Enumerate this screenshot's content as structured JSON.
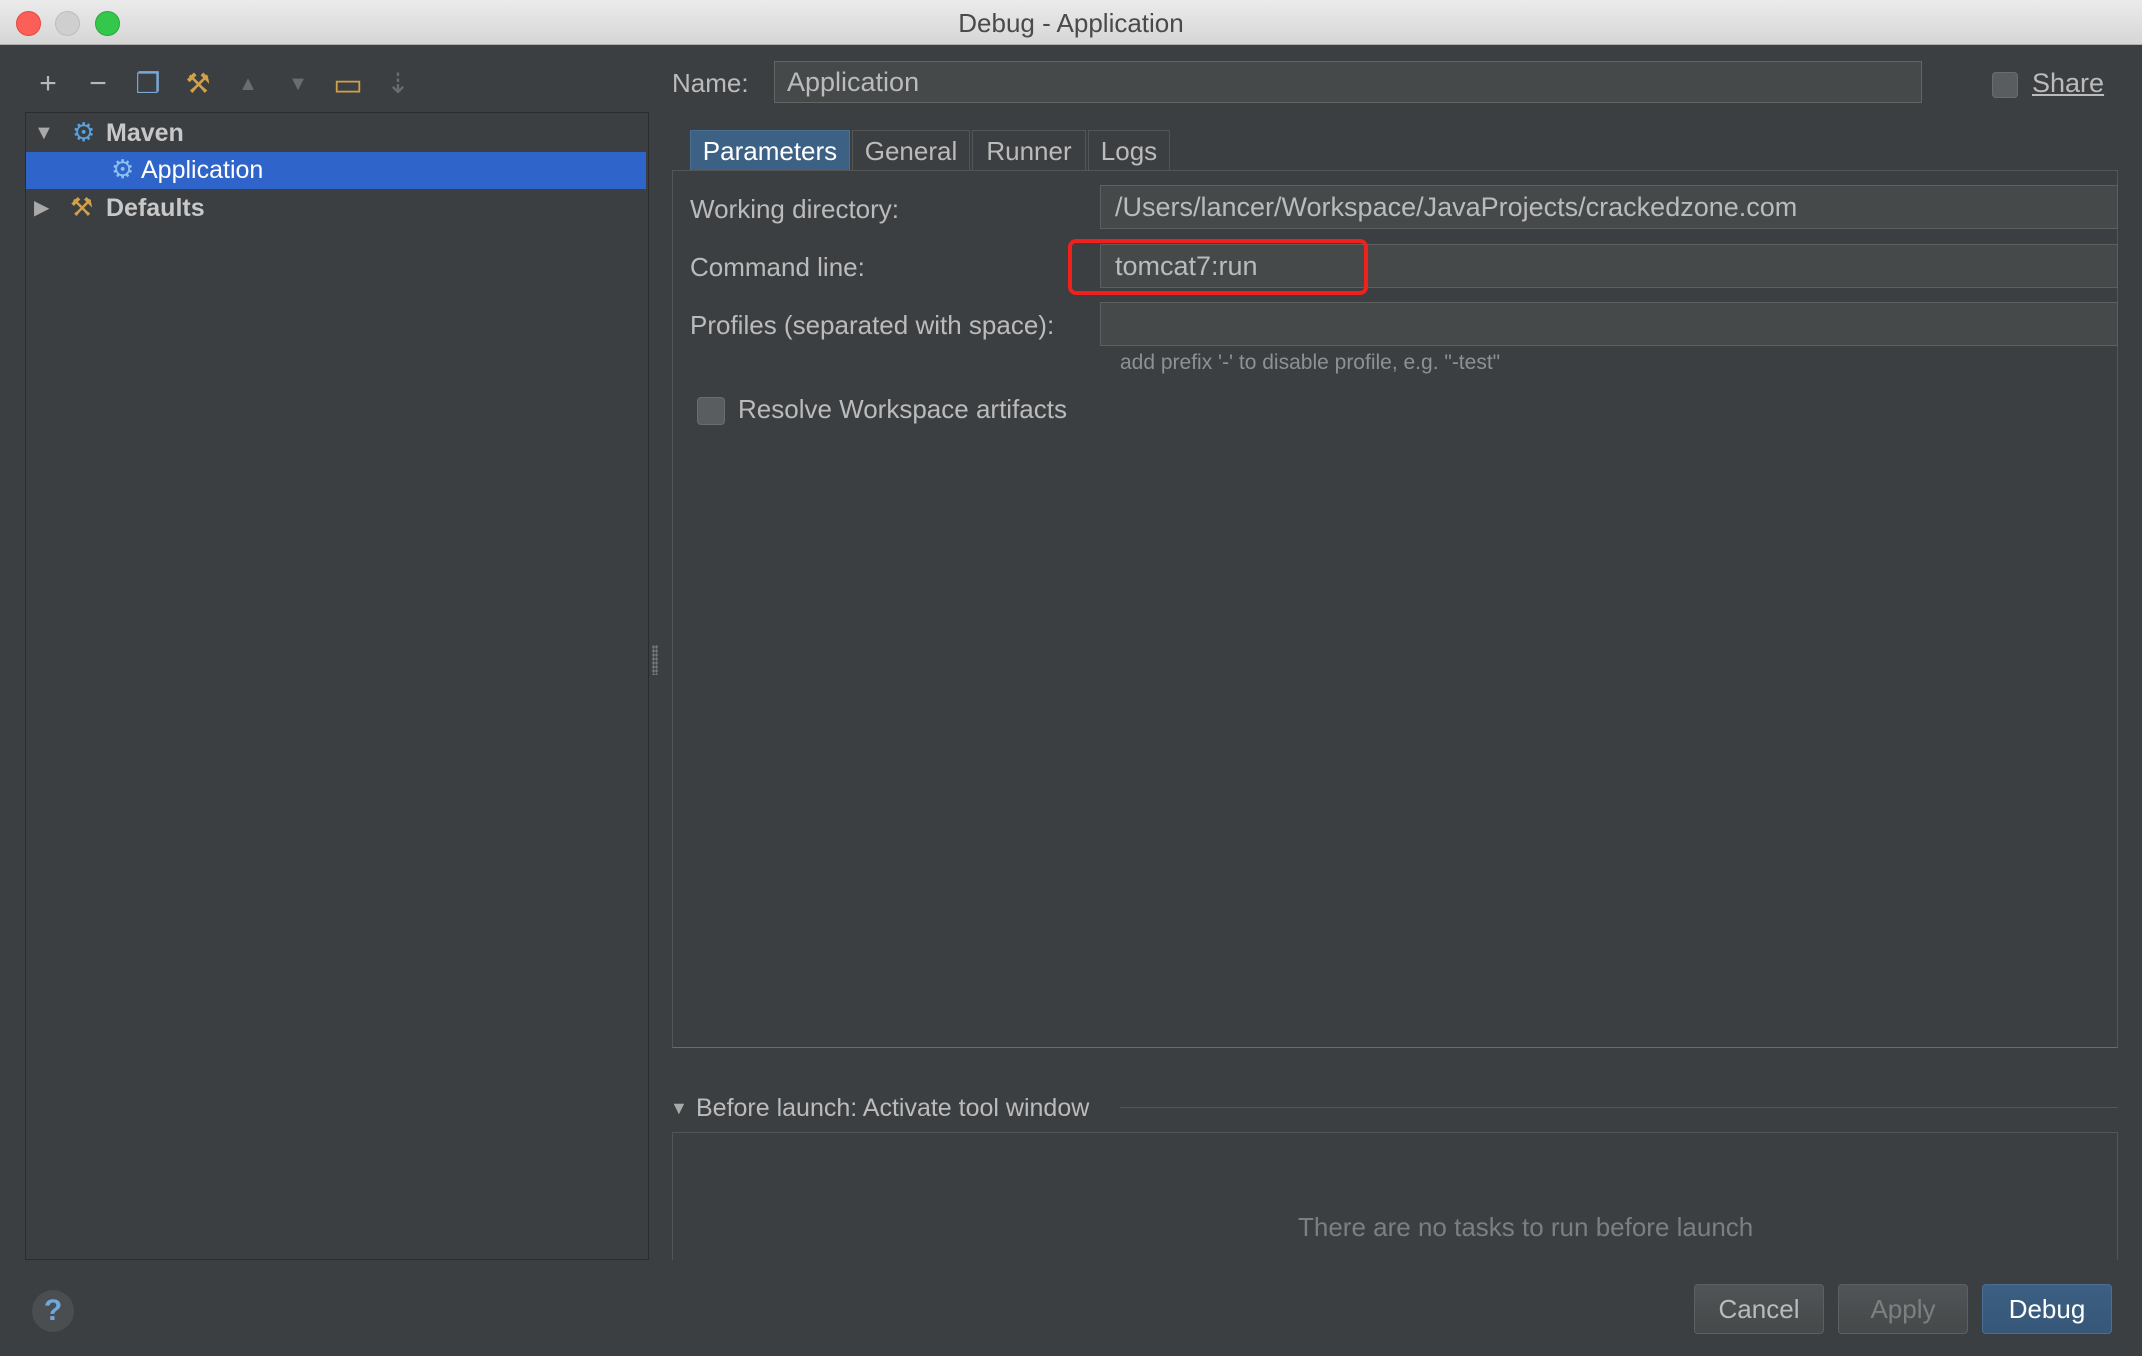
{
  "window": {
    "title": "Debug - Application"
  },
  "toolbar": {
    "items": [
      {
        "name": "add-icon",
        "glyph": "+"
      },
      {
        "name": "remove-icon",
        "glyph": "−"
      },
      {
        "name": "copy-icon",
        "glyph": "❐"
      },
      {
        "name": "wrench-icon",
        "glyph": "⚒"
      },
      {
        "name": "move-up-icon",
        "glyph": "▲"
      },
      {
        "name": "move-down-icon",
        "glyph": "▼"
      },
      {
        "name": "folder-icon",
        "glyph": "▭"
      },
      {
        "name": "sort-icon",
        "glyph": "⇣"
      }
    ]
  },
  "tree": {
    "maven": {
      "label": "Maven",
      "icon": "gear-icon"
    },
    "application": {
      "label": "Application",
      "icon": "gear-icon"
    },
    "defaults": {
      "label": "Defaults",
      "icon": "wrench-icon"
    }
  },
  "form": {
    "name_label": "Name:",
    "name_value": "Application",
    "share_label": "Share",
    "tabs": [
      "Parameters",
      "General",
      "Runner",
      "Logs"
    ],
    "working_dir_label": "Working directory:",
    "working_dir_value": "/Users/lancer/Workspace/JavaProjects/crackedzone.com",
    "command_line_label": "Command line:",
    "command_line_value": "tomcat7:run",
    "profiles_label": "Profiles (separated with space):",
    "profiles_value": "",
    "profiles_hint": "add prefix '-' to disable profile, e.g. \"-test\"",
    "resolve_workspace_label": "Resolve Workspace artifacts"
  },
  "before_launch": {
    "label": "Before launch: Activate tool window",
    "empty_text": "There are no tasks to run before launch"
  },
  "buttons": {
    "help": "?",
    "cancel": "Cancel",
    "apply": "Apply",
    "debug": "Debug"
  },
  "colors": {
    "background": "#3c3f41",
    "selection": "#2f65ca",
    "highlight_border": "#f0201d",
    "tab_active": "#3d6185"
  }
}
